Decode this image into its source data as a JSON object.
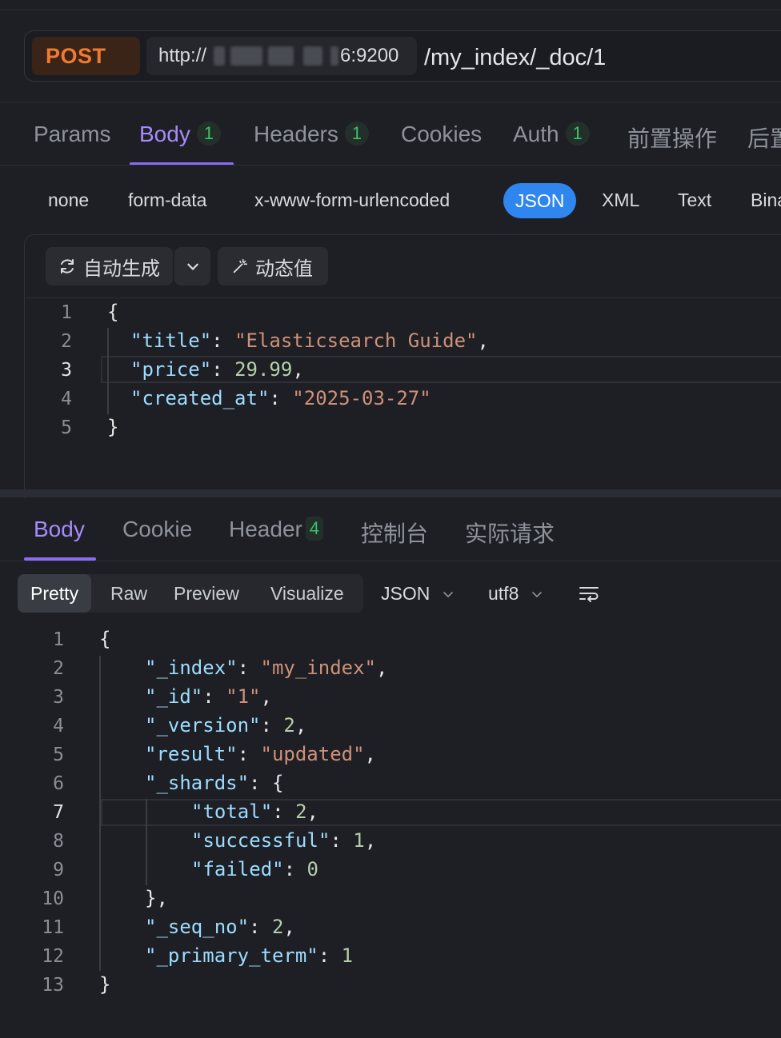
{
  "request": {
    "method": "POST",
    "url_prefix": "http://",
    "url_suffix": "6:9200",
    "path": "/my_index/_doc/1"
  },
  "request_tabs": [
    {
      "label": "Params"
    },
    {
      "label": "Body",
      "badge": "1",
      "active": true
    },
    {
      "label": "Headers",
      "badge": "1"
    },
    {
      "label": "Cookies"
    },
    {
      "label": "Auth",
      "badge": "1"
    },
    {
      "label": "前置操作"
    },
    {
      "label": "后置"
    }
  ],
  "body_types": [
    "none",
    "form-data",
    "x-www-form-urlencoded",
    "JSON",
    "XML",
    "Text",
    "Binary"
  ],
  "body_type_selected": "JSON",
  "editor_toolbar": {
    "auto_generate": "自动生成",
    "dynamic_value": "动态值"
  },
  "request_body": {
    "line_numbers": [
      "1",
      "2",
      "3",
      "4",
      "5"
    ],
    "current_line": 3,
    "title_key": "\"title\"",
    "title_val": "\"Elasticsearch Guide\"",
    "price_key": "\"price\"",
    "price_val": "29.99",
    "created_key": "\"created_at\"",
    "created_val": "\"2025-03-27\""
  },
  "response_tabs": [
    {
      "label": "Body",
      "active": true
    },
    {
      "label": "Cookie"
    },
    {
      "label": "Header",
      "badge": "4"
    },
    {
      "label": "控制台"
    },
    {
      "label": "实际请求"
    }
  ],
  "view_modes": [
    "Pretty",
    "Raw",
    "Preview",
    "Visualize"
  ],
  "view_mode_selected": "Pretty",
  "format_select": "JSON",
  "encoding_select": "utf8",
  "response_body": {
    "line_numbers": [
      "1",
      "2",
      "3",
      "4",
      "5",
      "6",
      "7",
      "8",
      "9",
      "10",
      "11",
      "12",
      "13"
    ],
    "current_line": 7,
    "index_key": "\"_index\"",
    "index_val": "\"my_index\"",
    "id_key": "\"_id\"",
    "id_val": "\"1\"",
    "version_key": "\"_version\"",
    "version_val": "2",
    "result_key": "\"result\"",
    "result_val": "\"updated\"",
    "shards_key": "\"_shards\"",
    "total_key": "\"total\"",
    "total_val": "2",
    "successful_key": "\"successful\"",
    "successful_val": "1",
    "failed_key": "\"failed\"",
    "failed_val": "0",
    "seq_key": "\"_seq_no\"",
    "seq_val": "2",
    "term_key": "\"_primary_term\"",
    "term_val": "1"
  },
  "colors": {
    "accent": "#a78bfa",
    "method": "#f07a2e",
    "selected_pill": "#2f86ee",
    "badge_text": "#3fbf6b"
  }
}
